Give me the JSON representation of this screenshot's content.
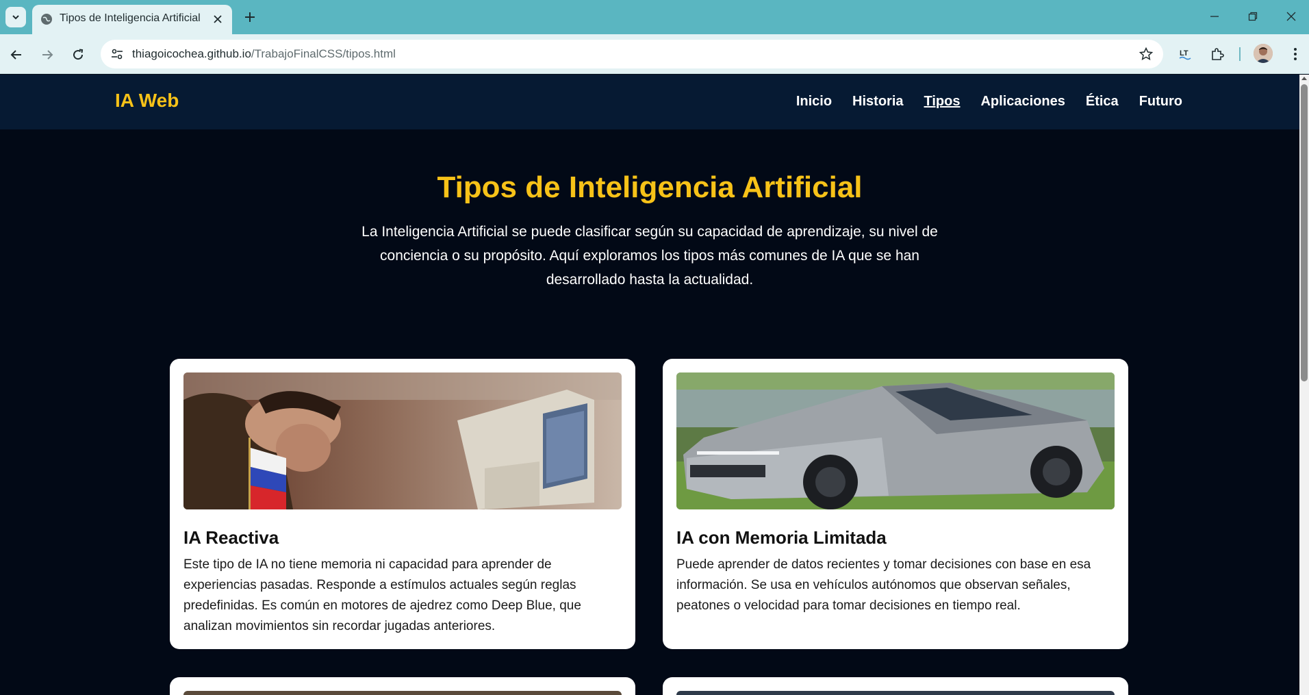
{
  "browser": {
    "tab_title": "Tipos de Inteligencia Artificial",
    "url_host": "thiagoicochea.github.io",
    "url_path": "/TrabajoFinalCSS/tipos.html",
    "new_tab_label": "+",
    "close_tab_label": "✕",
    "minimize_label": "—",
    "restore_label": "❐",
    "close_window_label": "✕"
  },
  "site": {
    "logo": "IA Web",
    "nav": [
      "Inicio",
      "Historia",
      "Tipos",
      "Aplicaciones",
      "Ética",
      "Futuro"
    ],
    "active_nav": "Tipos"
  },
  "hero": {
    "title": "Tipos de Inteligencia Artificial",
    "text": "La Inteligencia Artificial se puede clasificar según su capacidad de aprendizaje, su nivel de conciencia o su propósito. Aquí exploramos los tipos más comunes de IA que se han desarrollado hasta la actualidad."
  },
  "cards": [
    {
      "title": "IA Reactiva",
      "text": "Este tipo de IA no tiene memoria ni capacidad para aprender de experiencias pasadas. Responde a estímulos actuales según reglas predefinidas. Es común en motores de ajedrez como Deep Blue, que analizan movimientos sin recordar jugadas anteriores.",
      "image_icon": "chess-player-computer-photo"
    },
    {
      "title": "IA con Memoria Limitada",
      "text": "Puede aprender de datos recientes y tomar decisiones con base en esa información. Se usa en vehículos autónomos que observan señales, peatones o velocidad para tomar decisiones en tiempo real.",
      "image_icon": "autonomous-truck-photo"
    }
  ],
  "colors": {
    "accent": "#f7c218",
    "header_bg": "#061a33",
    "page_bg": "#020916",
    "chrome": "#5ab6c1"
  }
}
